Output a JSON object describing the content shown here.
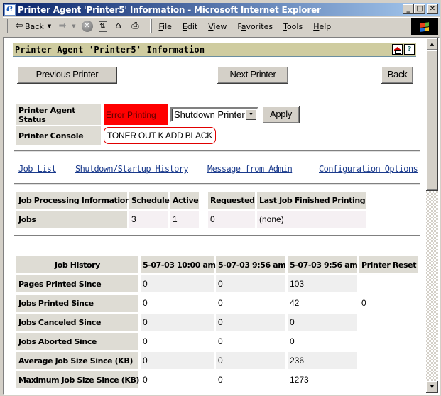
{
  "window": {
    "title": "Printer Agent 'Printer5' Information - Microsoft Internet Explorer",
    "controls": {
      "minimize": "_",
      "maximize": "□",
      "close": "✕"
    }
  },
  "toolbar": {
    "back_label": "Back",
    "menu": [
      "File",
      "Edit",
      "View",
      "Favorites",
      "Tools",
      "Help"
    ],
    "menu_underline": [
      "F",
      "E",
      "V",
      "a",
      "T",
      "H"
    ]
  },
  "page": {
    "header_title": "Printer Agent 'Printer5' Information",
    "buttons": {
      "previous": "Previous Printer",
      "next": "Next Printer",
      "back": "Back",
      "apply": "Apply"
    },
    "status": {
      "label": "Printer Agent Status",
      "value": "Error Printing",
      "value_color": "#ff0000",
      "action_select": "Shutdown Printer"
    },
    "console": {
      "label": "Printer Console",
      "message": "TONER OUT K ADD BLACK"
    },
    "links": [
      "Job List",
      "Shutdown/Startup History",
      "Message from Admin",
      "Configuration Options"
    ],
    "job_processing": {
      "headers": [
        "Job Processing Information",
        "Scheduled",
        "Active",
        "Requested",
        "Last Job Finished Printing"
      ],
      "row": {
        "label": "Jobs",
        "values": [
          "3",
          "1",
          "0",
          "(none)"
        ]
      }
    },
    "job_history": {
      "headers": [
        "Job History",
        "5-07-03 10:00 am",
        "5-07-03 9:56 am",
        "5-07-03 9:56 am",
        "Printer Reset"
      ],
      "rows": [
        {
          "label": "Pages Printed Since",
          "values": [
            "0",
            "0",
            "103",
            ""
          ]
        },
        {
          "label": "Jobs Printed Since",
          "values": [
            "0",
            "0",
            "42",
            "0"
          ]
        },
        {
          "label": "Jobs Canceled Since",
          "values": [
            "0",
            "0",
            "0",
            ""
          ]
        },
        {
          "label": "Jobs Aborted Since",
          "values": [
            "0",
            "0",
            "0",
            ""
          ]
        },
        {
          "label": "Average Job Size Since (KB)",
          "values": [
            "0",
            "0",
            "236",
            ""
          ]
        },
        {
          "label": "Maximum Job Size Since (KB)",
          "values": [
            "0",
            "0",
            "1273",
            ""
          ]
        }
      ]
    }
  }
}
